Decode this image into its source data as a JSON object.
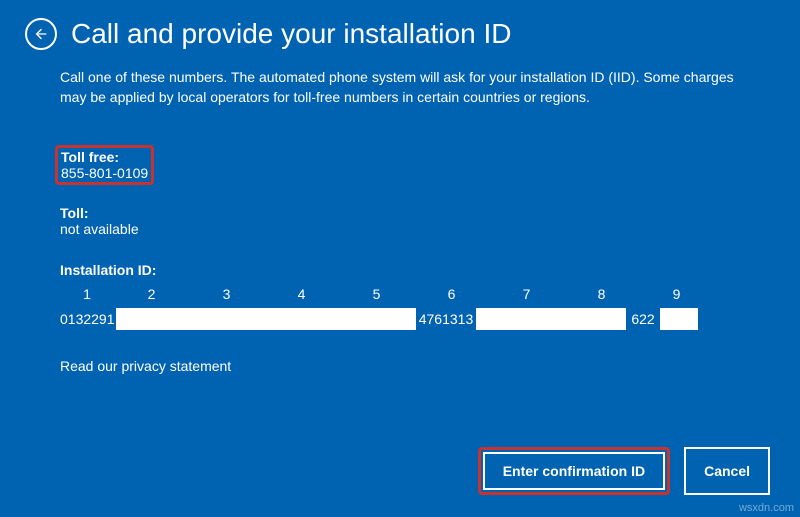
{
  "header": {
    "title": "Call and provide your installation ID"
  },
  "description": "Call one of these numbers. The automated phone system will ask for your installation ID (IID). Some charges may be applied by local operators for toll-free numbers in certain countries or regions.",
  "phone": {
    "toll_free_label": "Toll free:",
    "toll_free_value": "855-801-0109",
    "toll_label": "Toll:",
    "toll_value": "not available"
  },
  "iid": {
    "label": "Installation ID:",
    "cols": [
      "1",
      "2",
      "3",
      "4",
      "5",
      "6",
      "7",
      "8",
      "9"
    ],
    "group1": "0132291",
    "group6": "4761313",
    "group9": "622"
  },
  "privacy_link": "Read our privacy statement",
  "buttons": {
    "primary": "Enter confirmation ID",
    "cancel": "Cancel"
  },
  "watermark": "wsxdn.com"
}
